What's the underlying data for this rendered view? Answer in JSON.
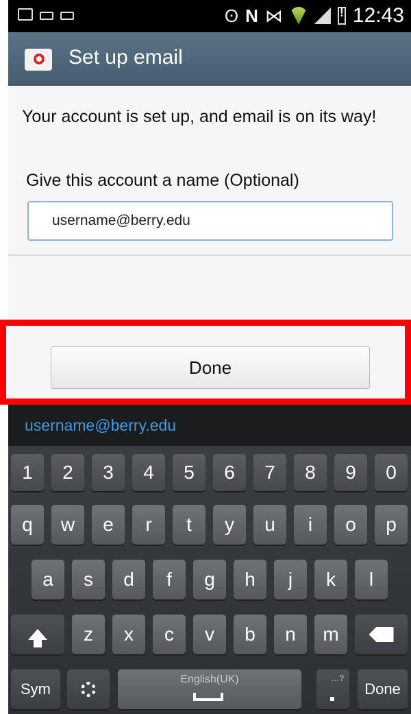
{
  "status_bar": {
    "time": "12:43",
    "network_label": "N",
    "icons": [
      "image-notification-icon",
      "voicemail-icon",
      "keyboard-notification-icon",
      "eye-icon",
      "nfc-icon",
      "vibrate-icon",
      "wifi-icon",
      "signal-icon",
      "battery-alert-icon"
    ]
  },
  "title_bar": {
    "title": "Set up email",
    "icon": "email-app-icon"
  },
  "content": {
    "message": "Your account is set up, and email is on its way!",
    "account_name_label": "Give this account a name (Optional)",
    "account_name_value": "username@berry.edu"
  },
  "done_button": {
    "label": "Done",
    "highlight_color": "#ff0000"
  },
  "suggestion_bar": {
    "suggestion": "username@berry.edu",
    "color": "#3f9be0"
  },
  "keyboard": {
    "number_row": [
      "1",
      "2",
      "3",
      "4",
      "5",
      "6",
      "7",
      "8",
      "9",
      "0"
    ],
    "row1": [
      "q",
      "w",
      "e",
      "r",
      "t",
      "y",
      "u",
      "i",
      "o",
      "p"
    ],
    "row2": [
      "a",
      "s",
      "d",
      "f",
      "g",
      "h",
      "j",
      "k",
      "l"
    ],
    "row3": [
      "z",
      "x",
      "c",
      "v",
      "b",
      "n",
      "m"
    ],
    "sym_label": "Sym",
    "space_label": "English(UK)",
    "done_label": "Done",
    "period_hint": "…?"
  }
}
